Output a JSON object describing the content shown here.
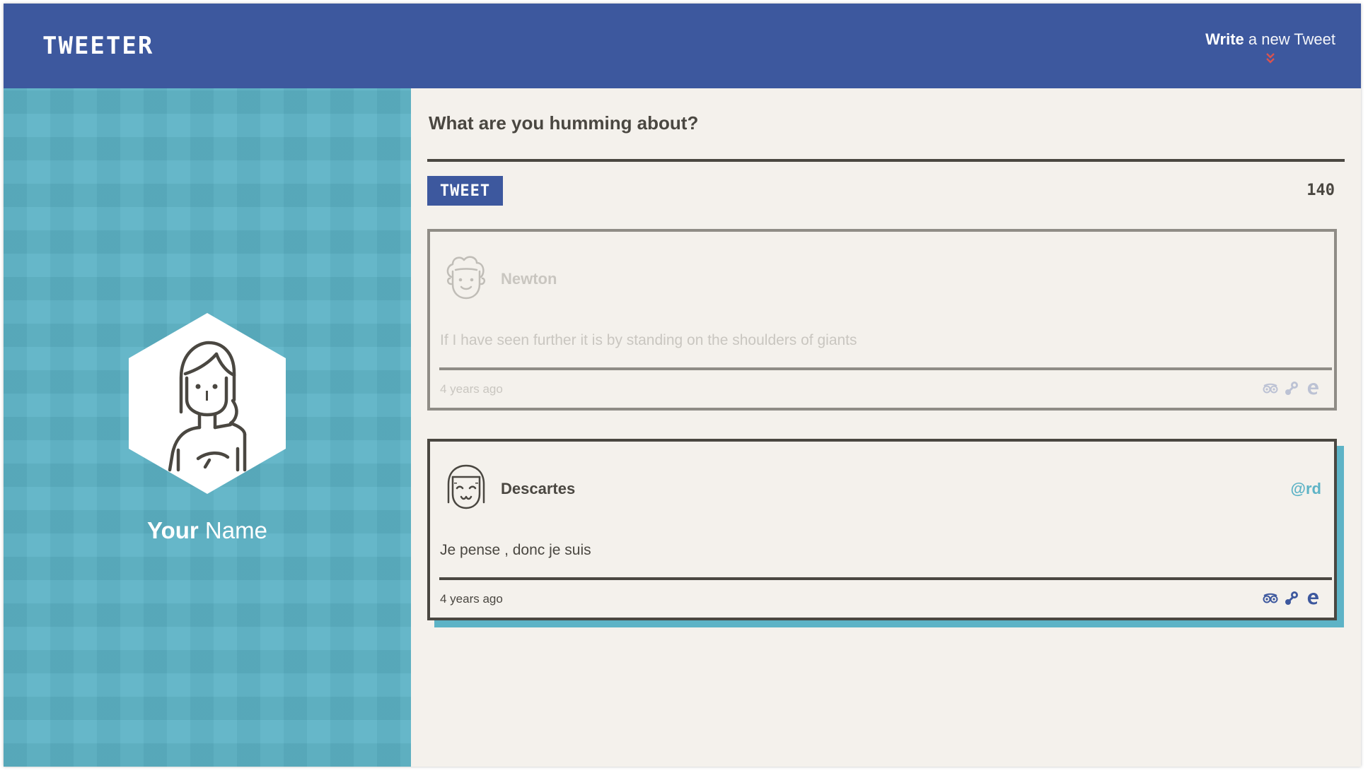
{
  "header": {
    "logo": "TWEETER",
    "write_strong": "Write",
    "write_light": " a new Tweet"
  },
  "profile": {
    "first_name": "Your",
    "last_name": " Name"
  },
  "compose": {
    "prompt": "What are you humming about?",
    "button_label": "TWEET",
    "char_count": "140"
  },
  "tweets": [
    {
      "author": "Newton",
      "handle": "",
      "text": "If I have seen further it is by standing on the shoulders of giants",
      "time": "4 years ago",
      "avatar_icon": "curly-hair-man-icon"
    },
    {
      "author": "Descartes",
      "handle": "@rd",
      "text": "Je pense , donc je suis",
      "time": "4 years ago",
      "avatar_icon": "bob-hair-woman-icon"
    }
  ],
  "action_icons": [
    "tripadvisor-icon",
    "steam-icon",
    "edge-icon"
  ],
  "colors": {
    "header": "#3d589e",
    "sidebar": "#5db3c6",
    "background": "#f4f1ec",
    "text": "#4a4741",
    "chevron": "#d9534f",
    "handle": "#5db3c6"
  }
}
